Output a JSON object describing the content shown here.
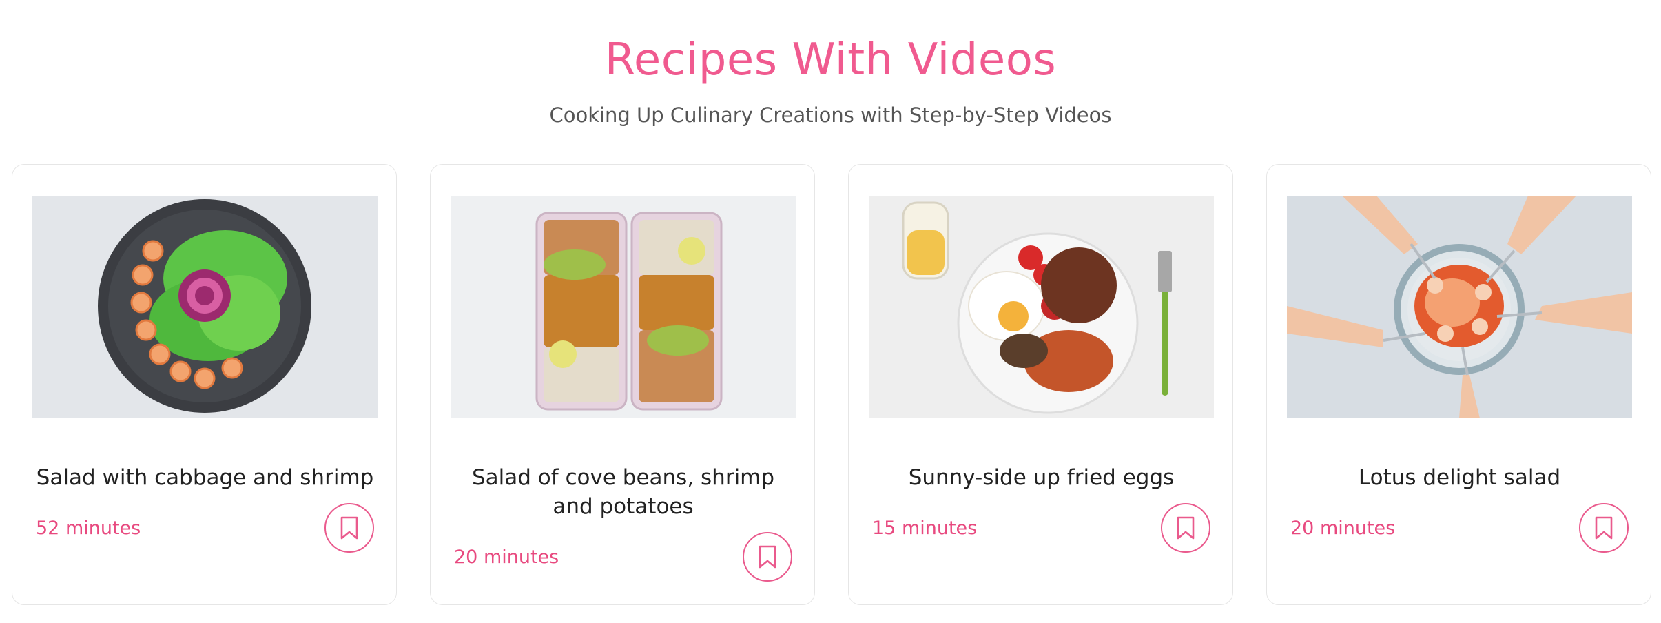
{
  "header": {
    "title": "Recipes With Videos",
    "subtitle": "Cooking Up Culinary Creations with Step-by-Step Videos"
  },
  "colors": {
    "accent": "#f05a8f",
    "time_text": "#e8497f",
    "title_text": "#222222",
    "subtitle_text": "#555555"
  },
  "cards": [
    {
      "title": "Salad with cabbage and shrimp",
      "time": "52 minutes",
      "image_alt": "shrimp cabbage salad bowl",
      "bookmark_icon": "bookmark-icon"
    },
    {
      "title": "Salad of cove beans, shrimp and potatoes",
      "time": "20 minutes",
      "image_alt": "lunch boxes with chickpeas and rice",
      "bookmark_icon": "bookmark-icon"
    },
    {
      "title": "Sunny-side up fried eggs",
      "time": "15 minutes",
      "image_alt": "breakfast plate with eggs and beans",
      "bookmark_icon": "bookmark-icon"
    },
    {
      "title": "Lotus delight salad",
      "time": "20 minutes",
      "image_alt": "shared salad with forks",
      "bookmark_icon": "bookmark-icon"
    }
  ]
}
